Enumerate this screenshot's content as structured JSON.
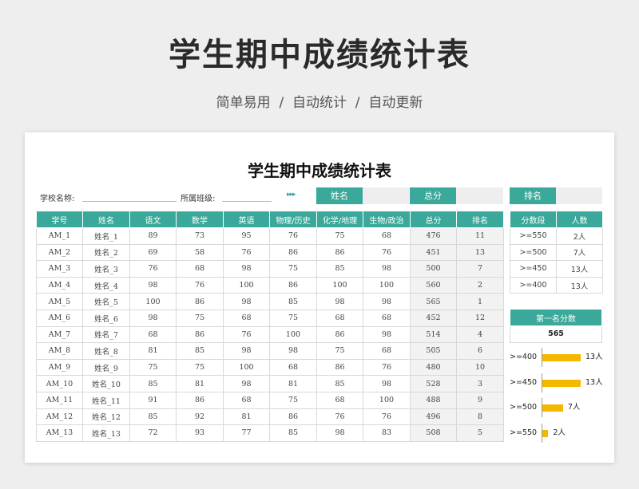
{
  "hero": {
    "title": "学生期中成绩统计表",
    "subtitle": "简单易用  /  自动统计  /  自动更新"
  },
  "sheet": {
    "title": "学生期中成绩统计表",
    "school_label": "学校名称:",
    "class_label": "所属班级:",
    "arrows": "▸▸▸",
    "name_label": "姓名",
    "total_label": "总分",
    "rank_label": "排名"
  },
  "table": {
    "headers": [
      "学号",
      "姓名",
      "语文",
      "数学",
      "英语",
      "物理/历史",
      "化学/地理",
      "生物/政治",
      "总分",
      "排名"
    ],
    "rows": [
      [
        "AM_1",
        "姓名_1",
        "89",
        "73",
        "95",
        "76",
        "75",
        "68",
        "476",
        "11"
      ],
      [
        "AM_2",
        "姓名_2",
        "69",
        "58",
        "76",
        "86",
        "86",
        "76",
        "451",
        "13"
      ],
      [
        "AM_3",
        "姓名_3",
        "76",
        "68",
        "98",
        "75",
        "85",
        "98",
        "500",
        "7"
      ],
      [
        "AM_4",
        "姓名_4",
        "98",
        "76",
        "100",
        "86",
        "100",
        "100",
        "560",
        "2"
      ],
      [
        "AM_5",
        "姓名_5",
        "100",
        "86",
        "98",
        "85",
        "98",
        "98",
        "565",
        "1"
      ],
      [
        "AM_6",
        "姓名_6",
        "98",
        "75",
        "68",
        "75",
        "68",
        "68",
        "452",
        "12"
      ],
      [
        "AM_7",
        "姓名_7",
        "68",
        "86",
        "76",
        "100",
        "86",
        "98",
        "514",
        "4"
      ],
      [
        "AM_8",
        "姓名_8",
        "81",
        "85",
        "98",
        "98",
        "75",
        "68",
        "505",
        "6"
      ],
      [
        "AM_9",
        "姓名_9",
        "75",
        "75",
        "100",
        "68",
        "86",
        "76",
        "480",
        "10"
      ],
      [
        "AM_10",
        "姓名_10",
        "85",
        "81",
        "98",
        "81",
        "85",
        "98",
        "528",
        "3"
      ],
      [
        "AM_11",
        "姓名_11",
        "91",
        "86",
        "68",
        "75",
        "68",
        "100",
        "488",
        "9"
      ],
      [
        "AM_12",
        "姓名_12",
        "85",
        "92",
        "81",
        "86",
        "76",
        "76",
        "496",
        "8"
      ],
      [
        "AM_13",
        "姓名_13",
        "72",
        "93",
        "77",
        "85",
        "98",
        "83",
        "508",
        "5"
      ]
    ]
  },
  "segments": {
    "headers": [
      "分数段",
      "人数"
    ],
    "rows": [
      [
        ">=550",
        "2人"
      ],
      [
        ">=500",
        "7人"
      ],
      [
        ">=450",
        "13人"
      ],
      [
        ">=400",
        "13人"
      ]
    ]
  },
  "first_place": {
    "label": "第一名分数",
    "value": "565"
  },
  "chart_data": {
    "type": "bar",
    "orientation": "horizontal",
    "categories": [
      ">=400",
      ">=450",
      ">=500",
      ">=550"
    ],
    "values": [
      13,
      13,
      7,
      2
    ],
    "data_labels": [
      "13人",
      "13人",
      "7人",
      "2人"
    ],
    "bar_color": "#f5b800",
    "xlim": [
      0,
      13
    ]
  },
  "colors": {
    "accent": "#3aa89a",
    "bar": "#f5b800"
  }
}
